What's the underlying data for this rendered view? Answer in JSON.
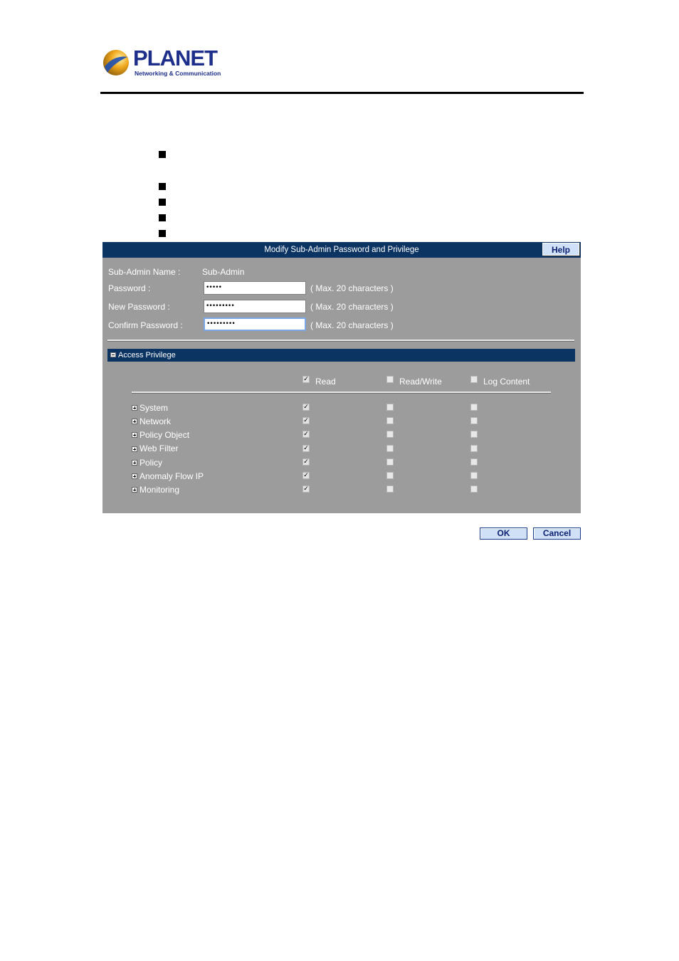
{
  "brand": {
    "name": "PLANET",
    "tagline": "Networking & Communication"
  },
  "dialog": {
    "title": "Modify Sub-Admin Password and Privilege",
    "help_label": "Help"
  },
  "fields": {
    "subadmin_name_label": "Sub-Admin Name :",
    "subadmin_name_value": "Sub-Admin",
    "password_label": "Password :",
    "password_value": "•••••",
    "new_password_label": "New Password :",
    "new_password_value": "•••••••••",
    "confirm_password_label": "Confirm Password :",
    "confirm_password_value": "•••••••••",
    "hint": "( Max. 20 characters )"
  },
  "privilege": {
    "section_label": "Access Privilege",
    "columns": [
      {
        "label": "Read",
        "checked": true
      },
      {
        "label": "Read/Write",
        "checked": false
      },
      {
        "label": "Log Content",
        "checked": false
      }
    ],
    "rows": [
      {
        "label": "System",
        "read": true,
        "read_write": false,
        "log": false
      },
      {
        "label": "Network",
        "read": true,
        "read_write": false,
        "log": false
      },
      {
        "label": "Policy Object",
        "read": true,
        "read_write": false,
        "log": false
      },
      {
        "label": "Web Filter",
        "read": true,
        "read_write": false,
        "log": false
      },
      {
        "label": "Policy",
        "read": true,
        "read_write": false,
        "log": false
      },
      {
        "label": "Anomaly Flow IP",
        "read": true,
        "read_write": false,
        "log": false
      },
      {
        "label": "Monitoring",
        "read": true,
        "read_write": false,
        "log": false
      }
    ]
  },
  "actions": {
    "ok_label": "OK",
    "cancel_label": "Cancel"
  },
  "colors": {
    "title_bar": "#0b3463",
    "panel_bg": "#9c9c9c",
    "brand_blue": "#1d2f8a"
  }
}
